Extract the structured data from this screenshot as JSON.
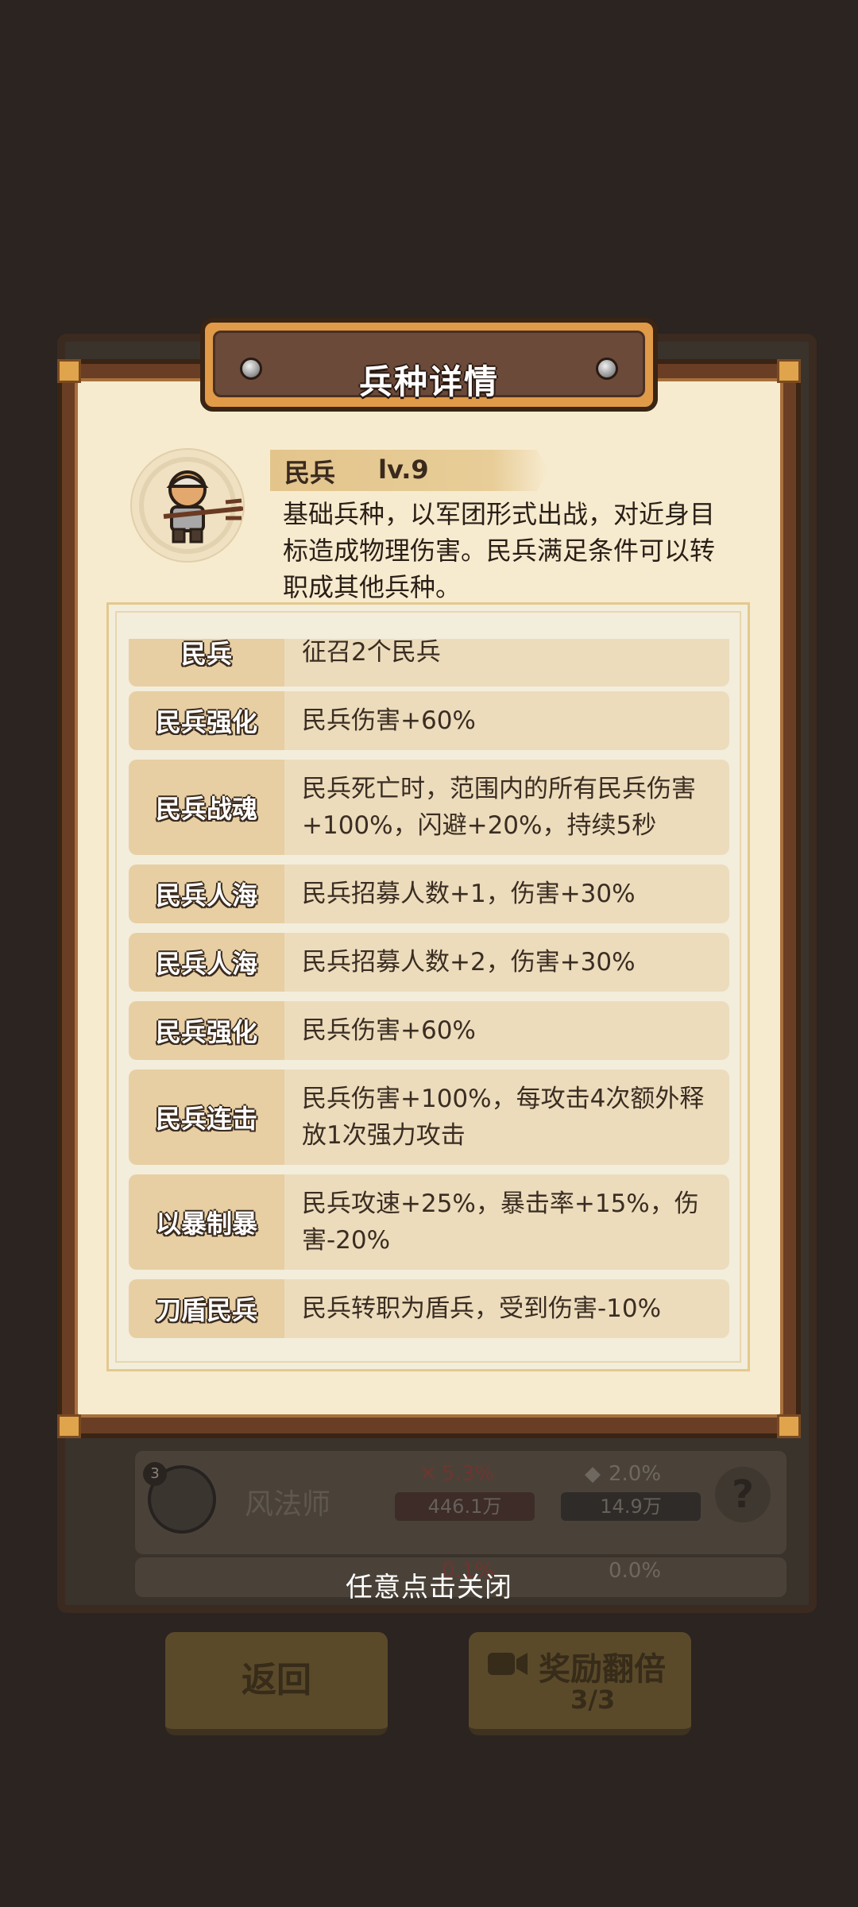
{
  "dialog": {
    "title": "兵种详情",
    "unit": {
      "name": "民兵",
      "level": "lv.9",
      "description": "基础兵种，以军团形式出战，对近身目标造成物理伤害。民兵满足条件可以转职成其他兵种。"
    },
    "talents": [
      {
        "name": "民兵",
        "effect": "征召2个民兵"
      },
      {
        "name": "民兵强化",
        "effect": "民兵伤害+60%"
      },
      {
        "name": "民兵战魂",
        "effect": "民兵死亡时，范围内的所有民兵伤害+100%，闪避+20%，持续5秒"
      },
      {
        "name": "民兵人海",
        "effect": "民兵招募人数+1，伤害+30%"
      },
      {
        "name": "民兵人海",
        "effect": "民兵招募人数+2，伤害+30%"
      },
      {
        "name": "民兵强化",
        "effect": "民兵伤害+60%"
      },
      {
        "name": "民兵连击",
        "effect": "民兵伤害+100%，每攻击4次额外释放1次强力攻击"
      },
      {
        "name": "以暴制暴",
        "effect": "民兵攻速+25%，暴击率+15%，伤害-20%"
      },
      {
        "name": "刀盾民兵",
        "effect": "民兵转职为盾兵，受到伤害-10%"
      }
    ]
  },
  "close_hint": "任意点击关闭",
  "background": {
    "unit_row": {
      "level": "3",
      "name": "风法师",
      "attack_pct": "5.3%",
      "attack_value": "446.1万",
      "defense_pct": "2.0%",
      "defense_value": "14.9万",
      "help_icon_text": "?"
    },
    "unit_row_2": {
      "attack_pct": "0.1%",
      "defense_pct": "0.0%"
    },
    "back_button": "返回",
    "reward_button": "奖励翻倍",
    "reward_count": "3/3"
  },
  "colors": {
    "background": "#2b2420",
    "parchment": "#f7ebcf",
    "frame": "#6a3e24",
    "label_bg": "#e7cfa3",
    "desc_bg": "#ecdcbc"
  }
}
